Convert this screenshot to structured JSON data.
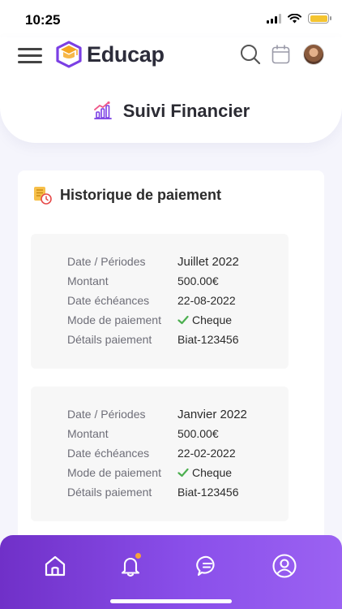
{
  "status_bar": {
    "time": "10:25"
  },
  "header": {
    "app_name": "Educap",
    "page_title": "Suivi Financier"
  },
  "colors": {
    "accent": "#7b3fe4",
    "logo_orange": "#f5a623",
    "check_green": "#4caf50",
    "battery": "#f4c430"
  },
  "icons": {
    "menu": "menu-icon",
    "search": "search-icon",
    "calendar": "calendar-icon",
    "finance": "finance-chart-icon",
    "history": "payment-history-icon",
    "home": "home-icon",
    "notifications": "bell-icon",
    "messages": "chat-icon",
    "profile": "user-icon"
  },
  "section": {
    "title": "Historique de paiement"
  },
  "labels": {
    "period": "Date / Périodes",
    "amount": "Montant",
    "due_date": "Date échéances",
    "mode": "Mode de paiement",
    "details": "Détails paiement"
  },
  "payments": [
    {
      "period": "Juillet 2022",
      "amount": "500.00€",
      "due_date": "22-08-2022",
      "mode": "Cheque",
      "details": "Biat-123456"
    },
    {
      "period": "Janvier 2022",
      "amount": "500.00€",
      "due_date": "22-02-2022",
      "mode": "Cheque",
      "details": "Biat-123456"
    }
  ]
}
